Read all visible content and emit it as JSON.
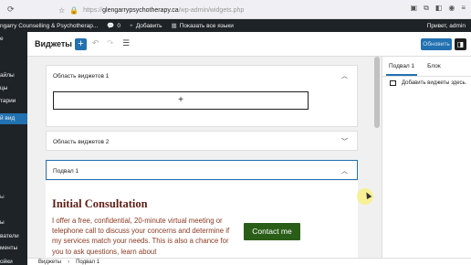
{
  "browser": {
    "url_prefix": "https://",
    "url_host": "glengarrypsychotherapy.ca",
    "url_path": "/wp-admin/widgets.php"
  },
  "admin_bar": {
    "site_name": "ngarry Counselling & Psychotherap...",
    "comments_count": "0",
    "new_label": "Добавить",
    "languages_label": "Показать все языки",
    "greeting": "Привет, admin"
  },
  "admin_menu": [
    {
      "label": "е",
      "state": "normal"
    },
    {
      "label": "айлы",
      "state": "normal"
    },
    {
      "label": "цы",
      "state": "normal"
    },
    {
      "label": "тарии",
      "state": "normal"
    },
    {
      "label": "й вид",
      "state": "active"
    },
    {
      "label": "ы",
      "state": "dim"
    },
    {
      "label": "ы",
      "state": "normal"
    },
    {
      "label": "ватели",
      "state": "normal"
    },
    {
      "label": "менты",
      "state": "normal"
    },
    {
      "label": "ойки",
      "state": "normal"
    }
  ],
  "editor": {
    "title": "Виджеты",
    "save_label": "Обновить"
  },
  "areas": [
    {
      "title": "Область виджетов 1",
      "expanded": true,
      "appender": "+"
    },
    {
      "title": "Область виджетов 2",
      "expanded": false
    },
    {
      "title": "Подвал 1",
      "expanded": true,
      "selected": true
    }
  ],
  "footer_widget": {
    "heading": "Initial Consultation",
    "body": "I offer a free, confidential, 20-minute virtual meeting or telephone call to discuss your concerns and determine if my services match your needs. This is also a chance for you to ask questions, learn about",
    "button_label": "Contact me",
    "heading_color": "#5e1f16",
    "button_color": "#2a5e18"
  },
  "inspector": {
    "tabs": [
      "Подвал 1",
      "Блок"
    ],
    "active_tab": "Подвал 1",
    "empty_text": "Добавить виджеты здесь."
  },
  "breadcrumb": [
    "Виджеты",
    "Подвал 1"
  ],
  "colors": {
    "accent": "#2271b1",
    "admin_bar": "#1d2327"
  }
}
